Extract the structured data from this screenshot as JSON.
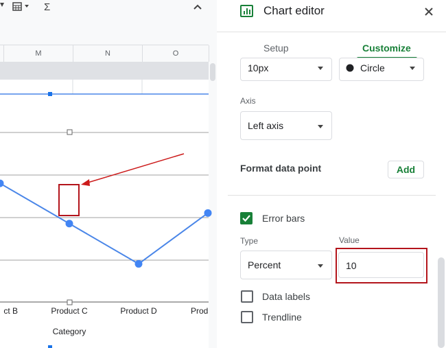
{
  "toolbar": {
    "items": [
      "filter-dropdown",
      "table-icon",
      "sigma-icon",
      "chevron-up-icon"
    ],
    "sigma_glyph": "Σ"
  },
  "sheet": {
    "columns": [
      "M",
      "N",
      "O"
    ]
  },
  "chart_data": {
    "type": "line",
    "xlabel": "Category",
    "categories": [
      "Product B",
      "Product C",
      "Product D",
      "Product"
    ],
    "tick_labels": [
      "ct B",
      "Product C",
      "Product D",
      "Prod"
    ],
    "series": [
      {
        "values": [
          11.6,
          9.7,
          7.8,
          10.2
        ],
        "error_bar_percent": 10
      }
    ],
    "colors": {
      "line": "#4a86e8",
      "marker": "#4285f4",
      "annotation": "#cc1b1b"
    }
  },
  "panel": {
    "title": "Chart editor",
    "tabs": {
      "setup": "Setup",
      "customize": "Customize"
    },
    "point_size": "10px",
    "point_shape": "Circle",
    "axis_label": "Axis",
    "axis_value": "Left axis",
    "format_data_point": "Format data point",
    "add_label": "Add",
    "error_bars_label": "Error bars",
    "type_label": "Type",
    "type_value": "Percent",
    "value_label": "Value",
    "value_value": "10",
    "data_labels_label": "Data labels",
    "trendline_label": "Trendline",
    "checks": {
      "error_bars": true,
      "data_labels": false,
      "trendline": false
    }
  }
}
